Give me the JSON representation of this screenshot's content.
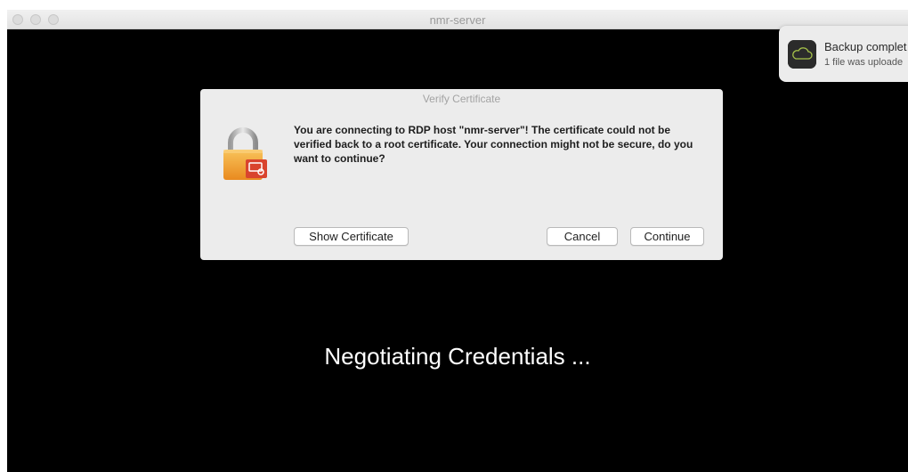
{
  "window": {
    "title": "nmr-server"
  },
  "dialog": {
    "title": "Verify Certificate",
    "message": "You are connecting to RDP host \"nmr-server\"! The certificate could not be verified back to a root certificate. Your connection might not be secure, do you want to continue?",
    "icon": "lock-certificate-icon",
    "buttons": {
      "show_certificate": "Show Certificate",
      "cancel": "Cancel",
      "continue": "Continue"
    }
  },
  "status": {
    "text": "Negotiating Credentials ..."
  },
  "notification": {
    "icon": "cloud-icon",
    "title": "Backup complet",
    "body": "1 file was uploade"
  },
  "colors": {
    "window_background": "#000000",
    "dialog_background": "#ececec",
    "lock_body": "#f2a33a",
    "badge": "#d9442e"
  }
}
